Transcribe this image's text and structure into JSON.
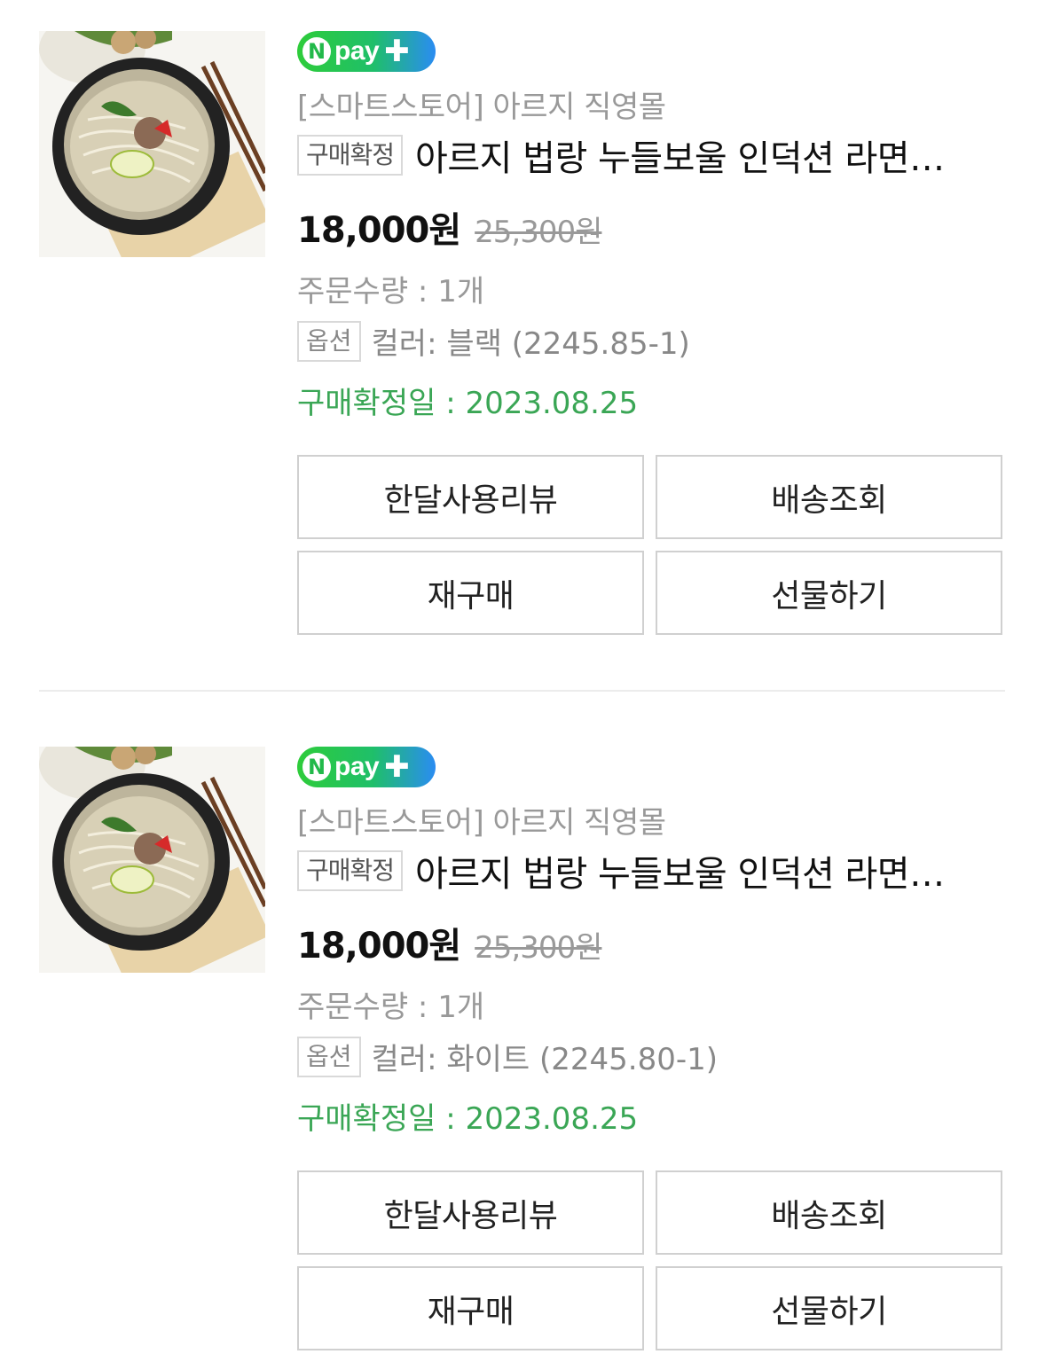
{
  "orders": [
    {
      "badge": "pay",
      "badge_n": "N",
      "store": "[스마트스토어] 아르지 직영몰",
      "status_tag": "구매확정",
      "title": "아르지 법랑 누들보울 인덕션 라면기 국수 그릇",
      "price": "18,000원",
      "original_price": "25,300원",
      "quantity": "주문수량 : 1개",
      "option_tag": "옵션",
      "option_text": "컬러: 블랙 (2245.85-1)",
      "confirm_date": "구매확정일 : 2023.08.25",
      "buttons": {
        "review": "한달사용리뷰",
        "track": "배송조회",
        "rebuy": "재구매",
        "gift": "선물하기"
      },
      "thumbnail_icon": "noodle-bowl-image"
    },
    {
      "badge": "pay",
      "badge_n": "N",
      "store": "[스마트스토어] 아르지 직영몰",
      "status_tag": "구매확정",
      "title": "아르지 법랑 누들보울 인덕션 라면기 국수 그릇",
      "price": "18,000원",
      "original_price": "25,300원",
      "quantity": "주문수량 : 1개",
      "option_tag": "옵션",
      "option_text": "컬러: 화이트 (2245.80-1)",
      "confirm_date": "구매확정일 : 2023.08.25",
      "buttons": {
        "review": "한달사용리뷰",
        "track": "배송조회",
        "rebuy": "재구매",
        "gift": "선물하기"
      },
      "thumbnail_icon": "noodle-bowl-image"
    }
  ],
  "colors": {
    "npay_green": "#2ecc3a",
    "npay_blue": "#2a8cf2",
    "confirm_green": "#3aa655",
    "muted_text": "#999999"
  }
}
